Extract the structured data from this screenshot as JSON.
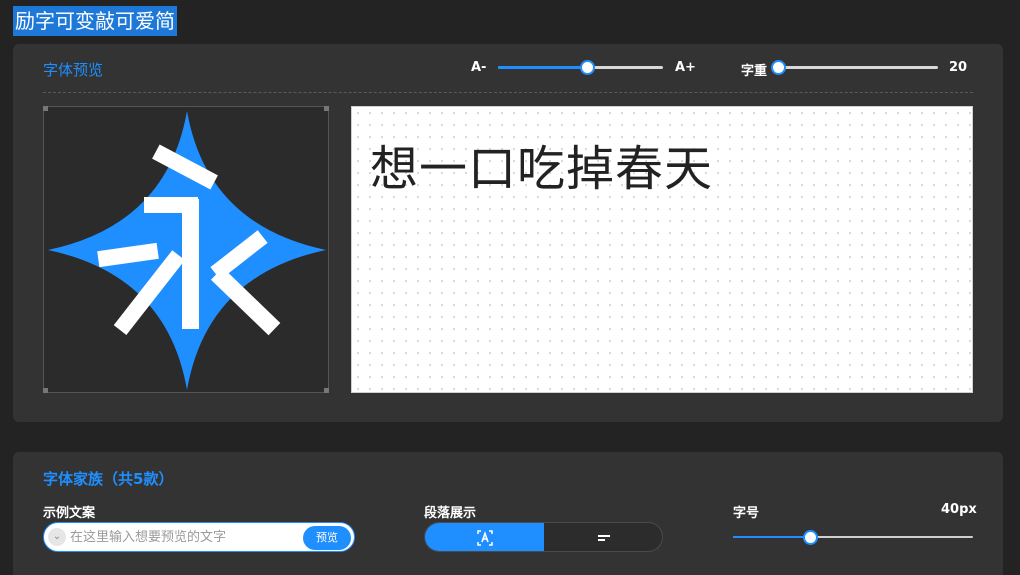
{
  "page": {
    "title": "励字可变敲可爱简"
  },
  "preview_panel": {
    "title": "字体预览",
    "size_minus": "A-",
    "size_plus": "A+",
    "size_level": 0.54,
    "weight_label": "字重",
    "weight_value": "20",
    "weight_level": 0.0,
    "glyph": "永",
    "preview_text": "想一口吃掉春天"
  },
  "family_panel": {
    "title": "字体家族（共5款）",
    "sample_label": "示例文案",
    "sample_placeholder": "在这里输入想要预览的文字",
    "sample_value": "",
    "preview_button": "预览",
    "paragraph_label": "段落展示",
    "font_size_label": "字号",
    "font_size_value": "40px",
    "font_size_level": 0.32
  },
  "colors": {
    "accent": "#1f8fff",
    "panel": "#333333",
    "background": "#232323"
  },
  "icons": [
    "chevron-down-icon",
    "text-box-icon",
    "paragraph-lines-icon"
  ]
}
